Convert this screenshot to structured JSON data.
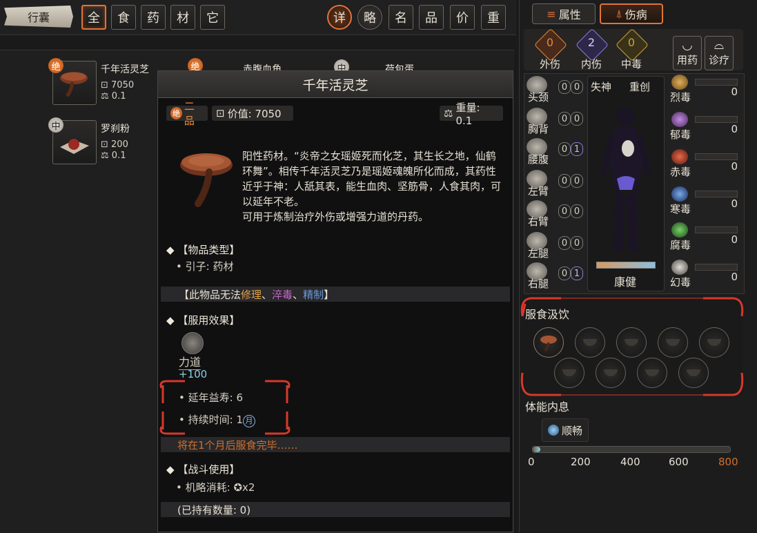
{
  "top_bar": {
    "bag_label": "行囊",
    "filters": [
      "全",
      "食",
      "药",
      "材",
      "它"
    ],
    "sorts": [
      "详",
      "略",
      "名",
      "品",
      "价",
      "重"
    ]
  },
  "inventory": [
    {
      "name": "千年活灵芝",
      "grade": "绝",
      "value": "7050",
      "weight": "0.1"
    },
    {
      "name": "赤腹血角",
      "grade": "绝"
    },
    {
      "name": "荷包蛋",
      "grade": "中"
    },
    {
      "name": "罗刹粉",
      "grade": "中",
      "value": "200",
      "weight": "0.1"
    }
  ],
  "tooltip": {
    "title": "千年活灵芝",
    "grade_badge": "绝",
    "grade_text": "二品",
    "value_label": "价值: 7050",
    "weight_label": "重量: 0.1",
    "description": "阳性药材。“炎帝之女瑶姬死而化芝，其生长之地，仙鹤环舞”。相传千年活灵芝乃是瑶姬魂魄所化而成，其药性近乎于神：人舐其表，能生血肉、坚筋骨，人食其肉，可以延年不老。",
    "usage": "可用于炼制治疗外伤或增强力道的丹药。",
    "type_header": "【物品类型】",
    "type_value": "• 引子: 药材",
    "restriction_prefix": "【此物品无法",
    "restriction_repair": "修理",
    "restriction_sep1": "、",
    "restriction_poison": "淬毒",
    "restriction_sep2": "、",
    "restriction_refine": "精制",
    "restriction_suffix": "】",
    "effect_header": "【服用效果】",
    "effect_stat_name": "力道",
    "effect_stat_value": "+100",
    "longevity_label": "• 延年益寿: 6",
    "duration_label": "• 持续时间: 1",
    "duration_unit": "月",
    "finish_note": "将在1个月后服食完毕……",
    "combat_header": "【战斗使用】",
    "combat_value": "• 机略消耗:",
    "combat_count": "x2",
    "owned_count": "(已持有数量: 0)"
  },
  "right_panel": {
    "tabs": [
      "属性",
      "伤病"
    ],
    "injury_stats": [
      {
        "label": "外伤",
        "value": "0",
        "color": "#e08a3a"
      },
      {
        "label": "内伤",
        "value": "2",
        "color": "#8a7ad6"
      },
      {
        "label": "中毒",
        "value": "0",
        "color": "#c9a33a"
      }
    ],
    "actions": [
      "用药",
      "诊疗"
    ],
    "body_parts": [
      {
        "label": "头颈",
        "a": "0",
        "b": "0"
      },
      {
        "label": "胸背",
        "a": "0",
        "b": "0"
      },
      {
        "label": "腰腹",
        "a": "0",
        "b": "1"
      },
      {
        "label": "左臂",
        "a": "0",
        "b": "0"
      },
      {
        "label": "右臂",
        "a": "0",
        "b": "0"
      },
      {
        "label": "左腿",
        "a": "0",
        "b": "0"
      },
      {
        "label": "右腿",
        "a": "0",
        "b": "1"
      }
    ],
    "mind_labels": [
      "失神",
      "重创"
    ],
    "health_label": "康健",
    "poisons": [
      {
        "label": "烈毒",
        "value": "0",
        "color": "#d9a43a"
      },
      {
        "label": "郁毒",
        "value": "0",
        "color": "#a86ad0"
      },
      {
        "label": "赤毒",
        "value": "0",
        "color": "#d8503a"
      },
      {
        "label": "寒毒",
        "value": "0",
        "color": "#5a8ad8"
      },
      {
        "label": "腐毒",
        "value": "0",
        "color": "#5ab04a"
      },
      {
        "label": "幻毒",
        "value": "0",
        "color": "#c8c4bc"
      }
    ],
    "eating_header": "服食汲饮",
    "energy_header": "体能内息",
    "energy_state": "顺畅",
    "energy_ticks": [
      "0",
      "200",
      "400",
      "600",
      "800"
    ],
    "energy_fraction": 0.04
  }
}
